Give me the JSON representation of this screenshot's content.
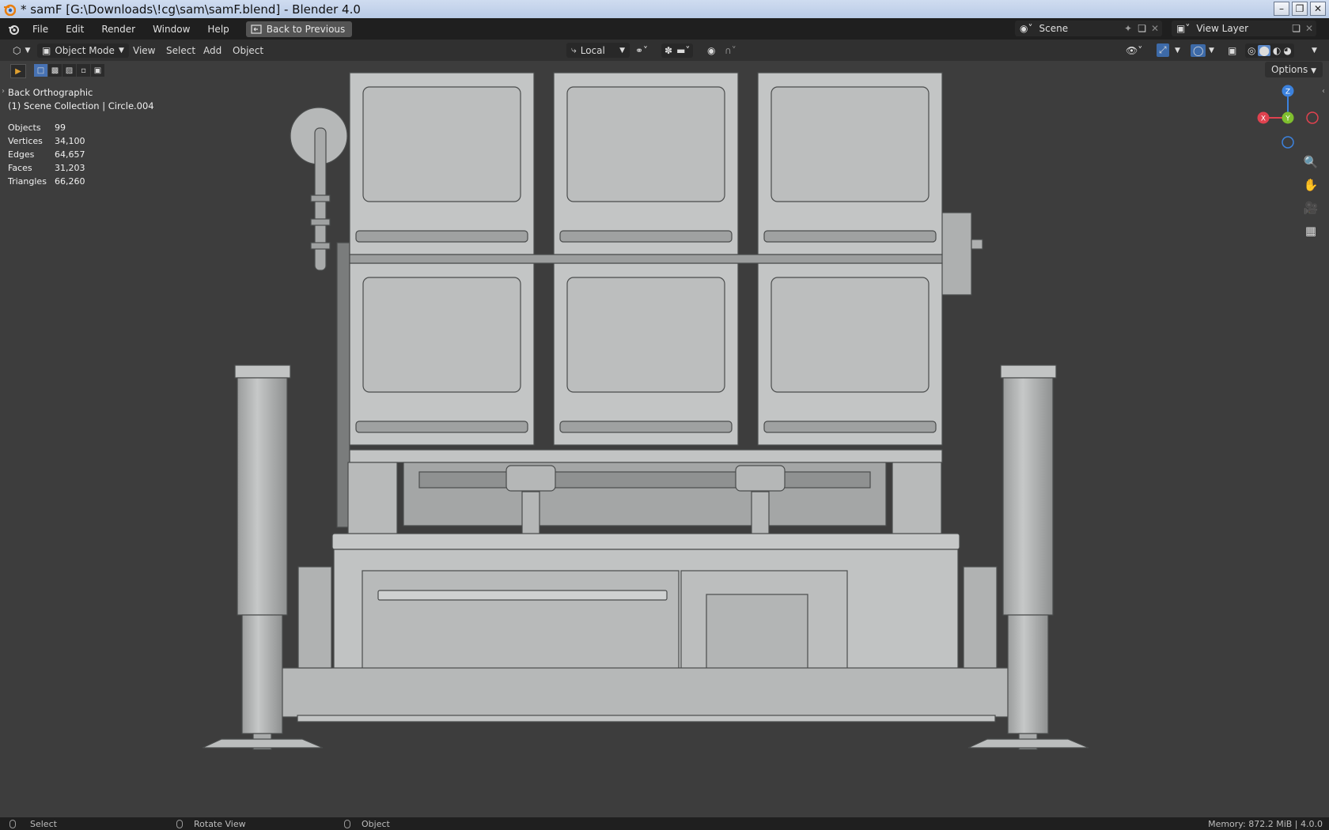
{
  "window": {
    "title": "* samF [G:\\Downloads\\!cg\\sam\\samF.blend] - Blender 4.0",
    "minimize": "–",
    "maximize": "❐",
    "close": "✕"
  },
  "menu": {
    "items": [
      "File",
      "Edit",
      "Render",
      "Window",
      "Help"
    ],
    "back_button": "Back to Previous",
    "scene": "Scene",
    "view_layer": "View Layer"
  },
  "header": {
    "mode": "Object Mode",
    "menus": [
      "View",
      "Select",
      "Add",
      "Object"
    ],
    "transform_orientation": "Local",
    "options": "Options"
  },
  "viewport": {
    "view_name": "Back Orthographic",
    "collection": "(1) Scene Collection | Circle.004",
    "stats": [
      {
        "label": "Objects",
        "value": "99"
      },
      {
        "label": "Vertices",
        "value": "34,100"
      },
      {
        "label": "Edges",
        "value": "64,657"
      },
      {
        "label": "Faces",
        "value": "31,203"
      },
      {
        "label": "Triangles",
        "value": "66,260"
      }
    ],
    "gizmo": {
      "z": "Z",
      "y": "Y",
      "x": "X"
    }
  },
  "status": {
    "select": "Select",
    "rotate": "Rotate View",
    "object": "Object",
    "memory": "Memory: 872.2 MiB | 4.0.0"
  },
  "colors": {
    "viewport_bg": "#3d3d3d",
    "model": "#bfc1c1",
    "axis_x": "#e0424f",
    "axis_y": "#7fbf2e",
    "axis_z": "#3c82de"
  }
}
